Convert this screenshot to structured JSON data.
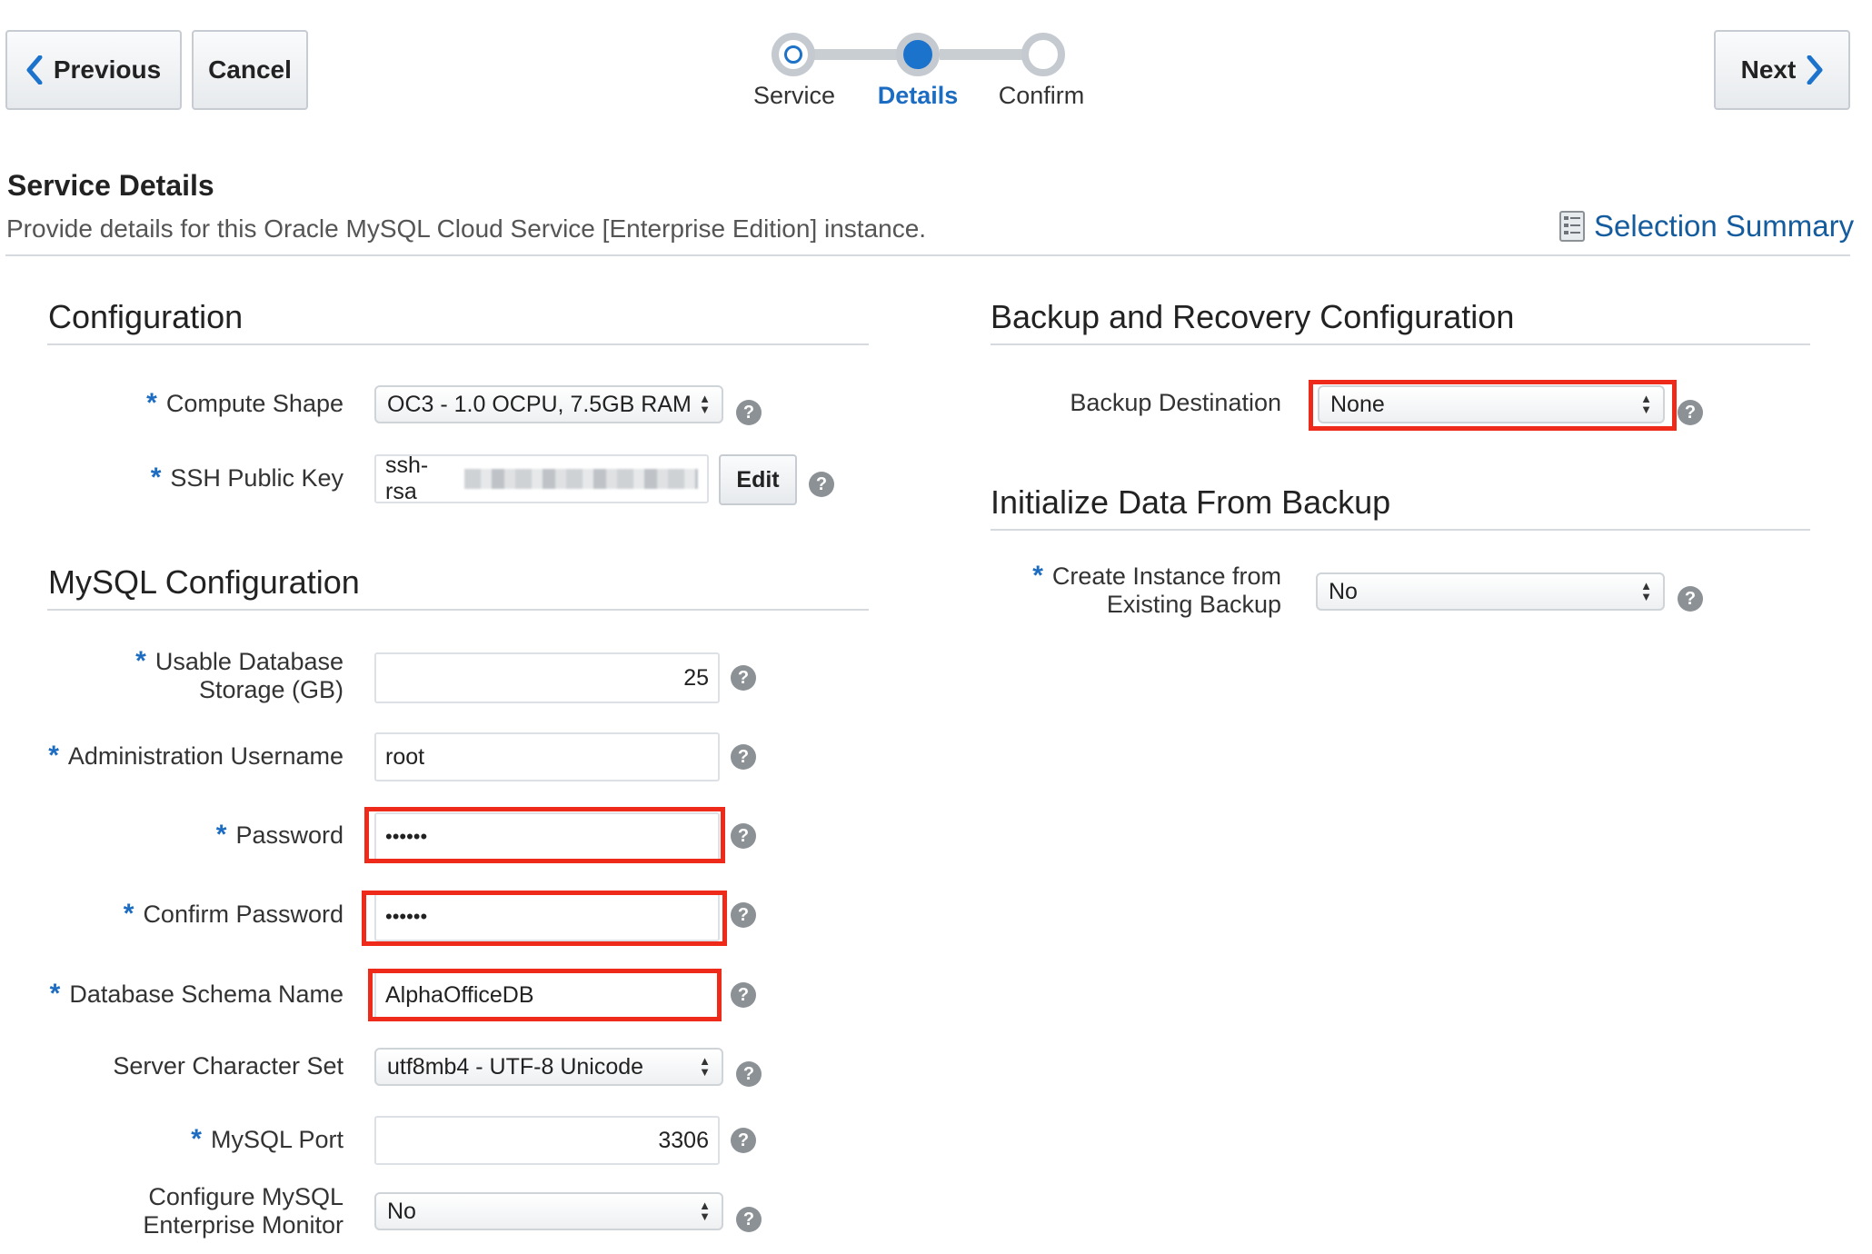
{
  "toolbar": {
    "previous_label": "Previous",
    "cancel_label": "Cancel",
    "next_label": "Next"
  },
  "train": {
    "steps": [
      {
        "label": "Service",
        "state": "visited"
      },
      {
        "label": "Details",
        "state": "current"
      },
      {
        "label": "Confirm",
        "state": "unvisited"
      }
    ]
  },
  "header": {
    "title": "Service Details",
    "description": "Provide details for this Oracle MySQL Cloud Service [Enterprise Edition] instance.",
    "selection_summary_label": "Selection Summary"
  },
  "configuration": {
    "title": "Configuration",
    "compute_shape": {
      "label": "Compute Shape",
      "required": true,
      "value": "OC3 - 1.0 OCPU, 7.5GB RAM"
    },
    "ssh_public_key": {
      "label": "SSH Public Key",
      "required": true,
      "value": "ssh-rsa",
      "edit_label": "Edit"
    }
  },
  "mysql_configuration": {
    "title": "MySQL Configuration",
    "usable_storage": {
      "label_line1": "Usable Database",
      "label_line2": "Storage (GB)",
      "required": true,
      "value": "25"
    },
    "admin_username": {
      "label": "Administration Username",
      "required": true,
      "value": "root"
    },
    "password": {
      "label": "Password",
      "required": true,
      "value": "••••••"
    },
    "confirm_password": {
      "label": "Confirm Password",
      "required": true,
      "value": "••••••"
    },
    "schema_name": {
      "label": "Database Schema Name",
      "required": true,
      "value": "AlphaOfficeDB"
    },
    "character_set": {
      "label": "Server Character Set",
      "required": false,
      "value": "utf8mb4 - UTF-8 Unicode"
    },
    "mysql_port": {
      "label": "MySQL Port",
      "required": true,
      "value": "3306"
    },
    "enterprise_monitor": {
      "label_line1": "Configure MySQL",
      "label_line2": "Enterprise Monitor",
      "required": false,
      "value": "No"
    }
  },
  "backup_recovery": {
    "title": "Backup and Recovery Configuration",
    "backup_destination": {
      "label": "Backup Destination",
      "required": false,
      "value": "None"
    }
  },
  "initialize_backup": {
    "title": "Initialize Data From Backup",
    "create_from_backup": {
      "label_line1": "Create Instance from",
      "label_line2": "Existing Backup",
      "required": true,
      "value": "No"
    }
  },
  "colors": {
    "accent": "#1c73cc",
    "highlight": "#ee2b1b",
    "link": "#145c9e"
  },
  "icons": {
    "help": "help-icon",
    "required": "*"
  }
}
